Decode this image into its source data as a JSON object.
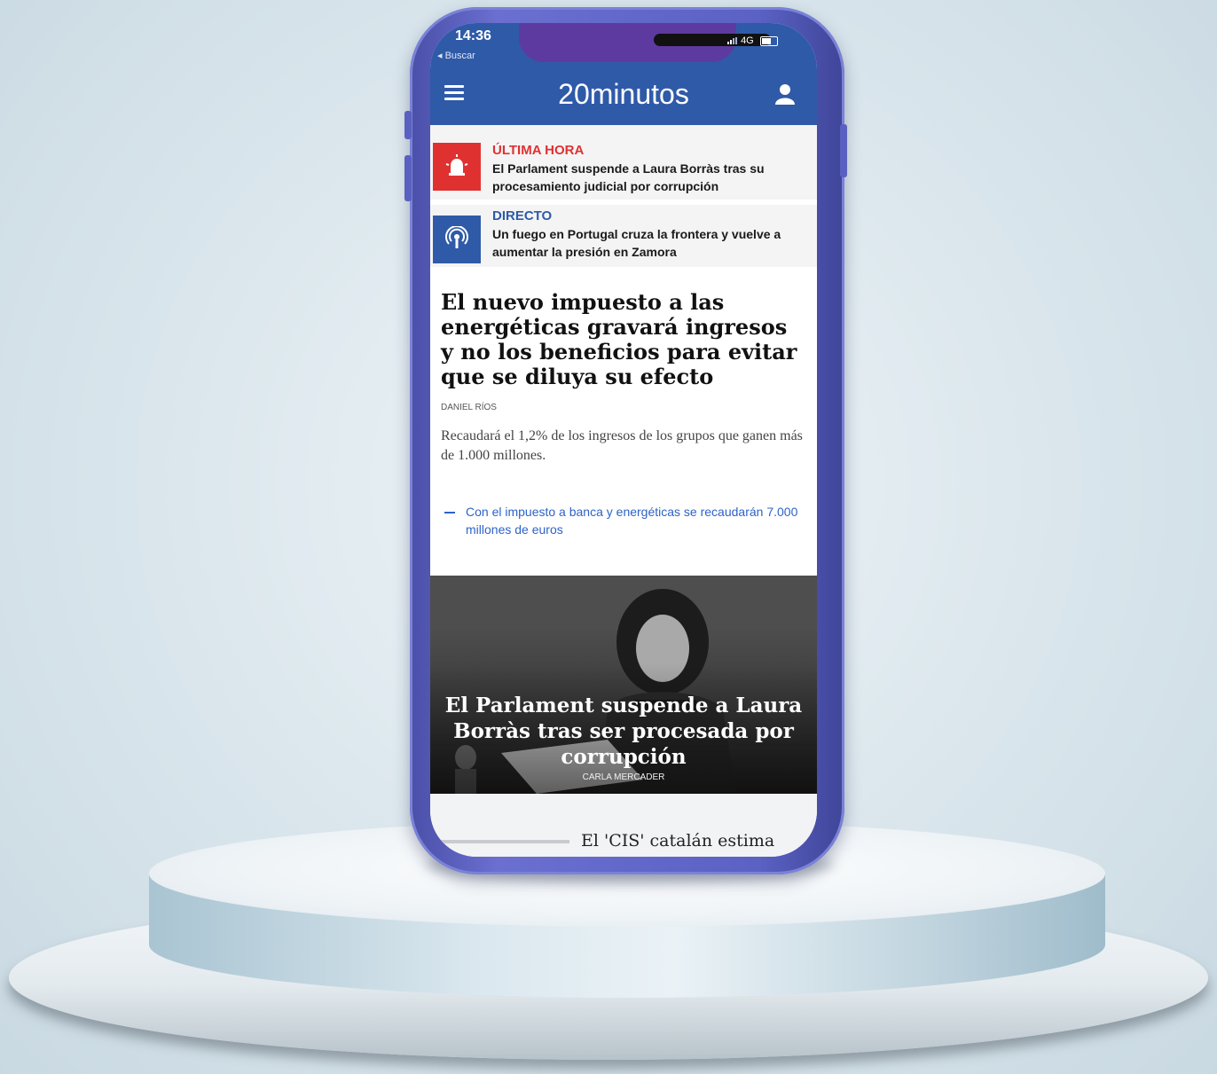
{
  "status_bar": {
    "time": "14:36",
    "back_label": "◂ Buscar",
    "network": "4G"
  },
  "header": {
    "logo": "20minutos",
    "menu_icon": "hamburger-menu-icon",
    "account_icon": "user-icon"
  },
  "alerts": [
    {
      "kicker": "ÚLTIMA HORA",
      "text": "El Parlament suspende a Laura Borràs tras su procesamiento judicial por corrupción",
      "icon": "bell-alarm-icon",
      "color": "#e03131"
    },
    {
      "kicker": "DIRECTO",
      "text": "Un fuego en Portugal cruza la frontera y vuelve a aumentar la presión en Zamora",
      "icon": "broadcast-icon",
      "color": "#2f5aa8"
    }
  ],
  "lead_article": {
    "title": "El nuevo impuesto a las energéticas gravará ingresos y no los beneficios para evitar que se diluya su efecto",
    "author": "DANIEL RÍOS",
    "summary": "Recaudará el 1,2% de los ingresos de los grupos que ganen más de 1.000 millones.",
    "related": "Con el impuesto a banca y energéticas se recaudarán 7.000 millones de euros"
  },
  "photo_article": {
    "title": "El Parlament suspende a Laura Borràs tras ser procesada por corrupción",
    "author": "CARLA MERCADER"
  },
  "next_article": {
    "title": "El 'CIS' catalán estima"
  },
  "colors": {
    "brand": "#2f5aa8",
    "alert_red": "#e03131",
    "link": "#2d63c8"
  }
}
